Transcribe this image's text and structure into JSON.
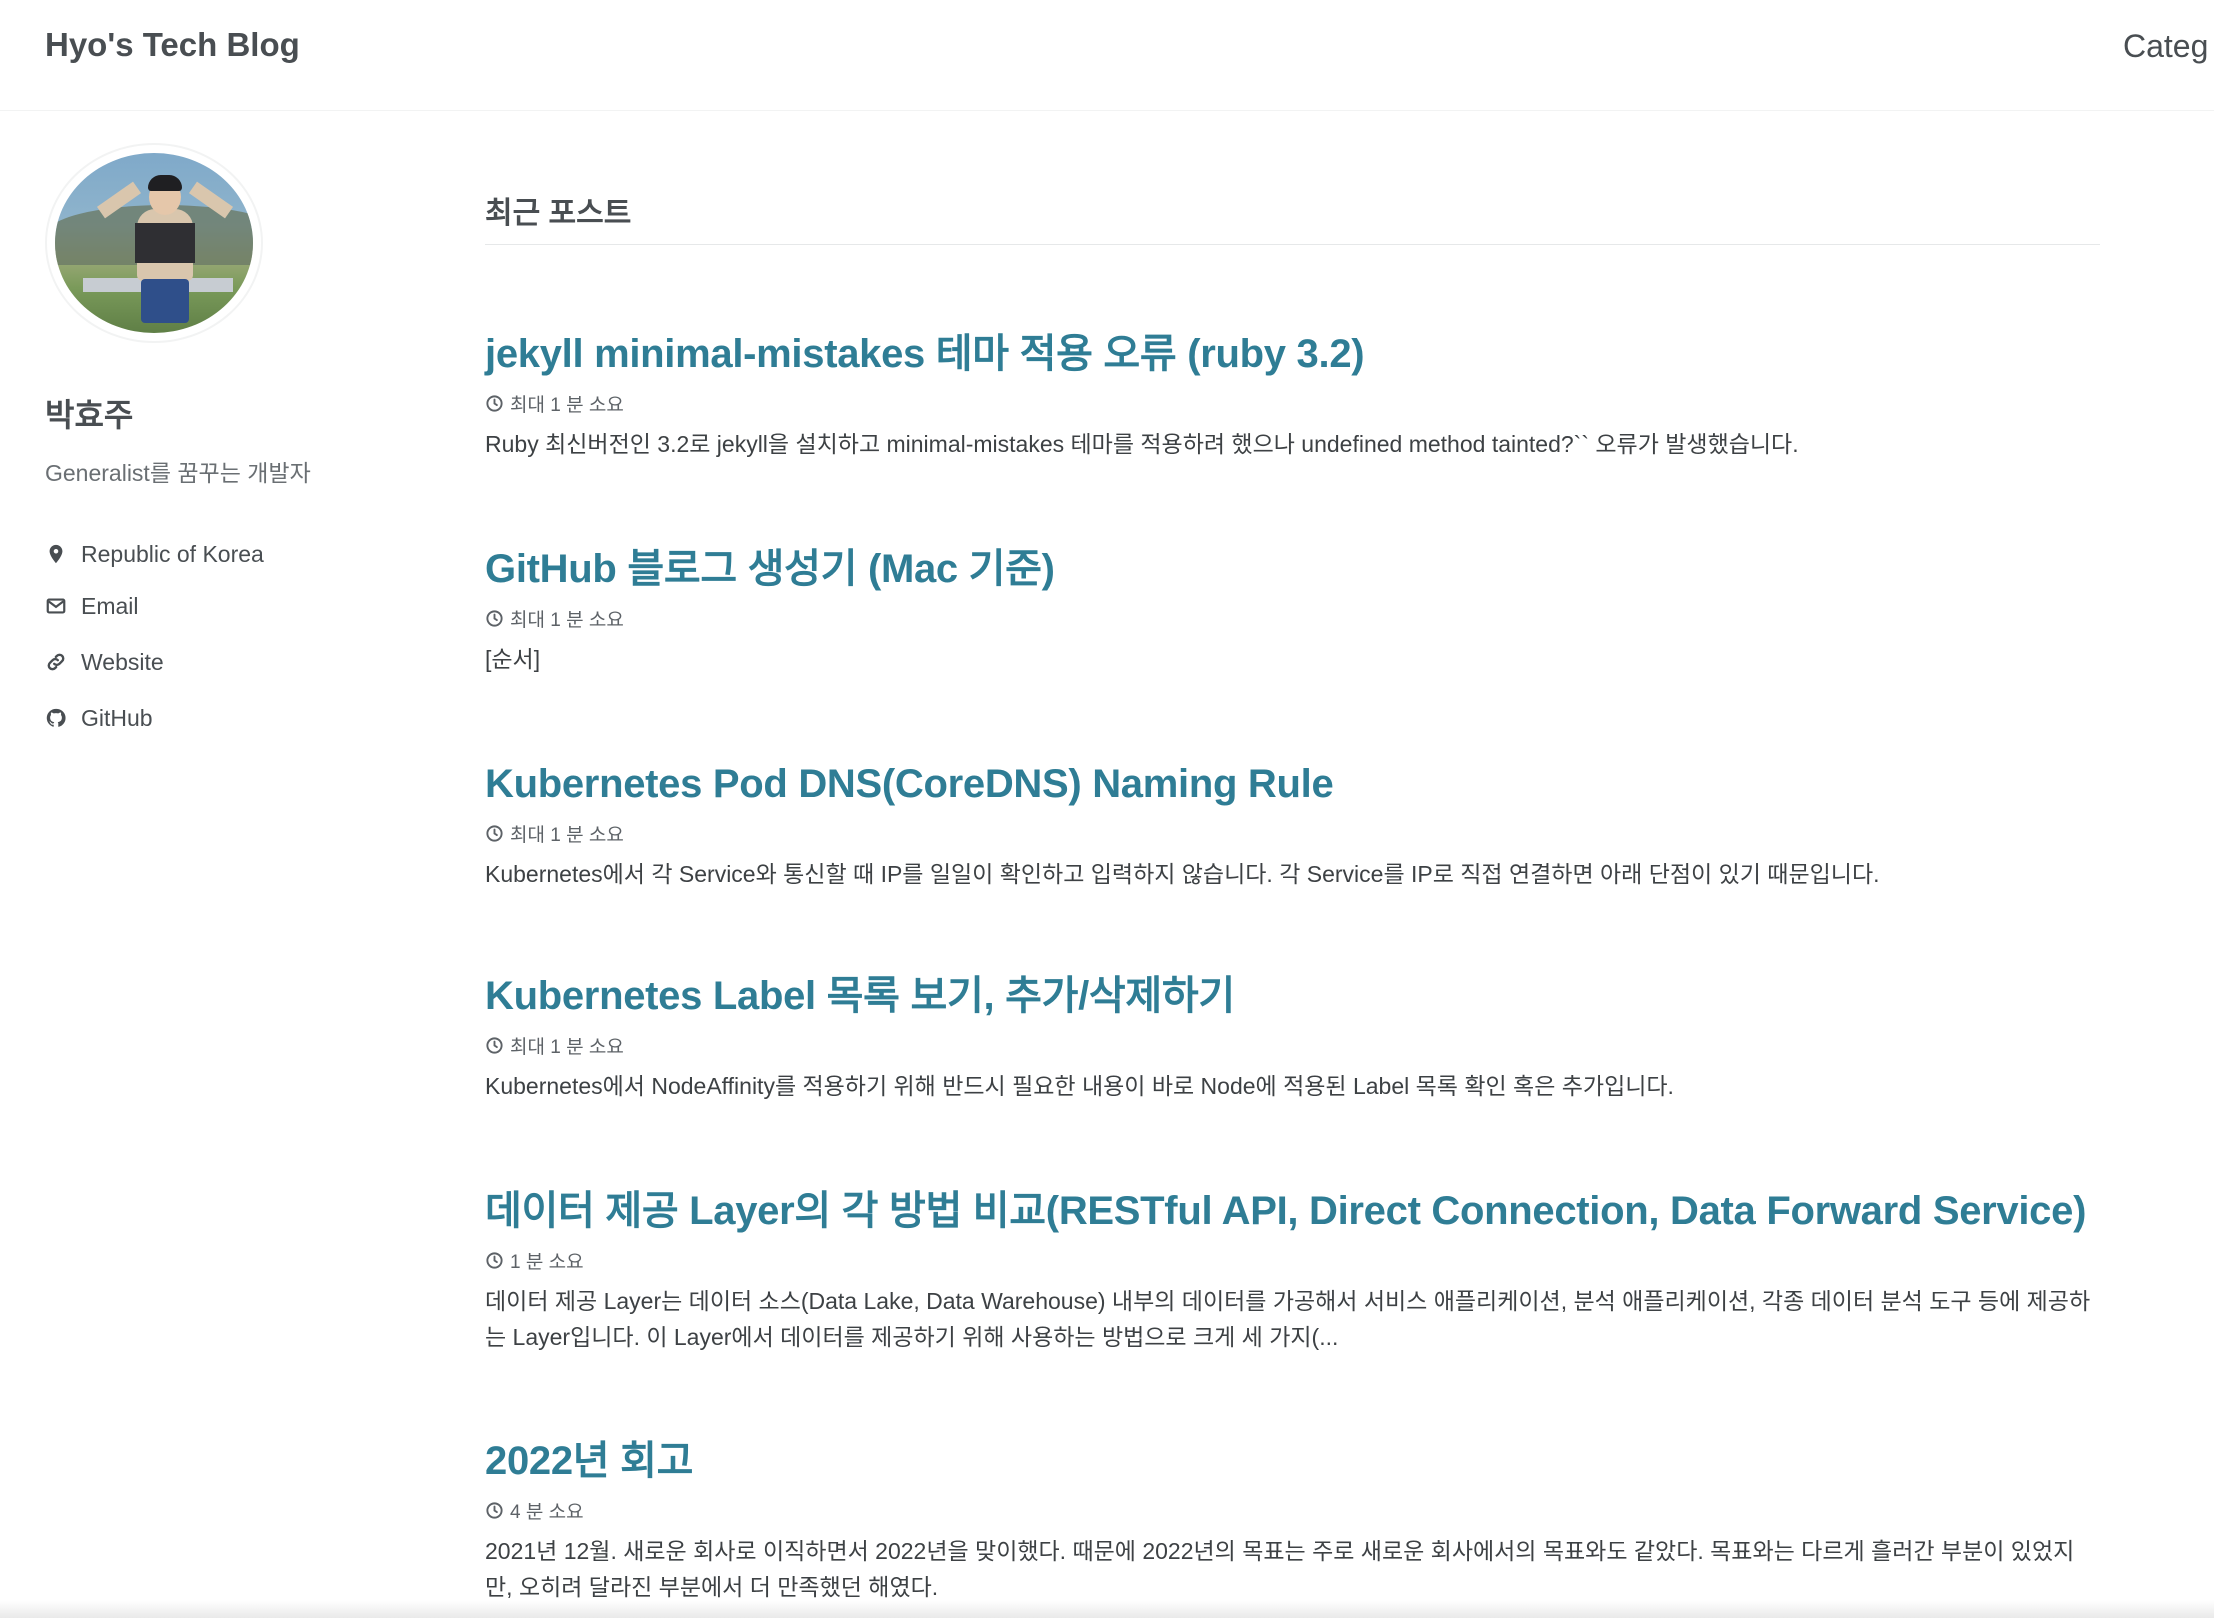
{
  "masthead": {
    "site_title": "Hyo's Tech Blog",
    "nav": [
      "Categ"
    ]
  },
  "sidebar": {
    "author_name": "박효주",
    "author_bio": "Generalist를 꿈꾸는 개발자",
    "links": [
      {
        "icon": "map-marker-icon",
        "label": "Republic of Korea"
      },
      {
        "icon": "envelope-icon",
        "label": "Email"
      },
      {
        "icon": "link-icon",
        "label": "Website"
      },
      {
        "icon": "github-icon",
        "label": "GitHub"
      }
    ]
  },
  "main": {
    "archive_title": "최근 포스트",
    "posts": [
      {
        "title": "jekyll minimal-mistakes 테마 적용 오류 (ruby 3.2)",
        "read_time": "최대 1 분 소요",
        "excerpt": "Ruby 최신버전인 3.2로 jekyll을 설치하고 minimal-mistakes 테마를 적용하려 했으나 undefined method tainted?`` 오류가 발생했습니다."
      },
      {
        "title": "GitHub 블로그 생성기 (Mac 기준)",
        "read_time": "최대 1 분 소요",
        "excerpt": "[순서]"
      },
      {
        "title": "Kubernetes Pod DNS(CoreDNS) Naming Rule",
        "read_time": "최대 1 분 소요",
        "excerpt": "Kubernetes에서 각 Service와 통신할 때 IP를 일일이 확인하고 입력하지 않습니다. 각 Service를 IP로 직접 연결하면 아래 단점이 있기 때문입니다."
      },
      {
        "title": "Kubernetes Label 목록 보기, 추가/삭제하기",
        "read_time": "최대 1 분 소요",
        "excerpt": "Kubernetes에서 NodeAffinity를 적용하기 위해 반드시 필요한 내용이 바로 Node에 적용된 Label 목록 확인 혹은 추가입니다."
      },
      {
        "title": "데이터 제공 Layer의 각 방법 비교(RESTful API, Direct Connection, Data Forward Service)",
        "read_time": "1 분 소요",
        "excerpt": "데이터 제공 Layer는 데이터 소스(Data Lake, Data Warehouse) 내부의 데이터를 가공해서 서비스 애플리케이션, 분석 애플리케이션, 각종 데이터 분석 도구 등에 제공하는 Layer입니다. 이 Layer에서 데이터를 제공하기 위해 사용하는 방법으로 크게 세 가지(..."
      },
      {
        "title": "2022년 회고",
        "read_time": "4 분 소요",
        "excerpt": "2021년 12월. 새로운 회사로 이직하면서 2022년을 맞이했다. 때문에 2022년의 목표는 주로 새로운 회사에서의 목표와도 같았다. 목표와는 다르게 흘러간 부분이 있었지만, 오히려 달라진 부분에서 더 만족했던 해였다."
      }
    ]
  },
  "colors": {
    "link": "#2f7d95",
    "text": "#494e52",
    "border": "#f2f3f3"
  }
}
